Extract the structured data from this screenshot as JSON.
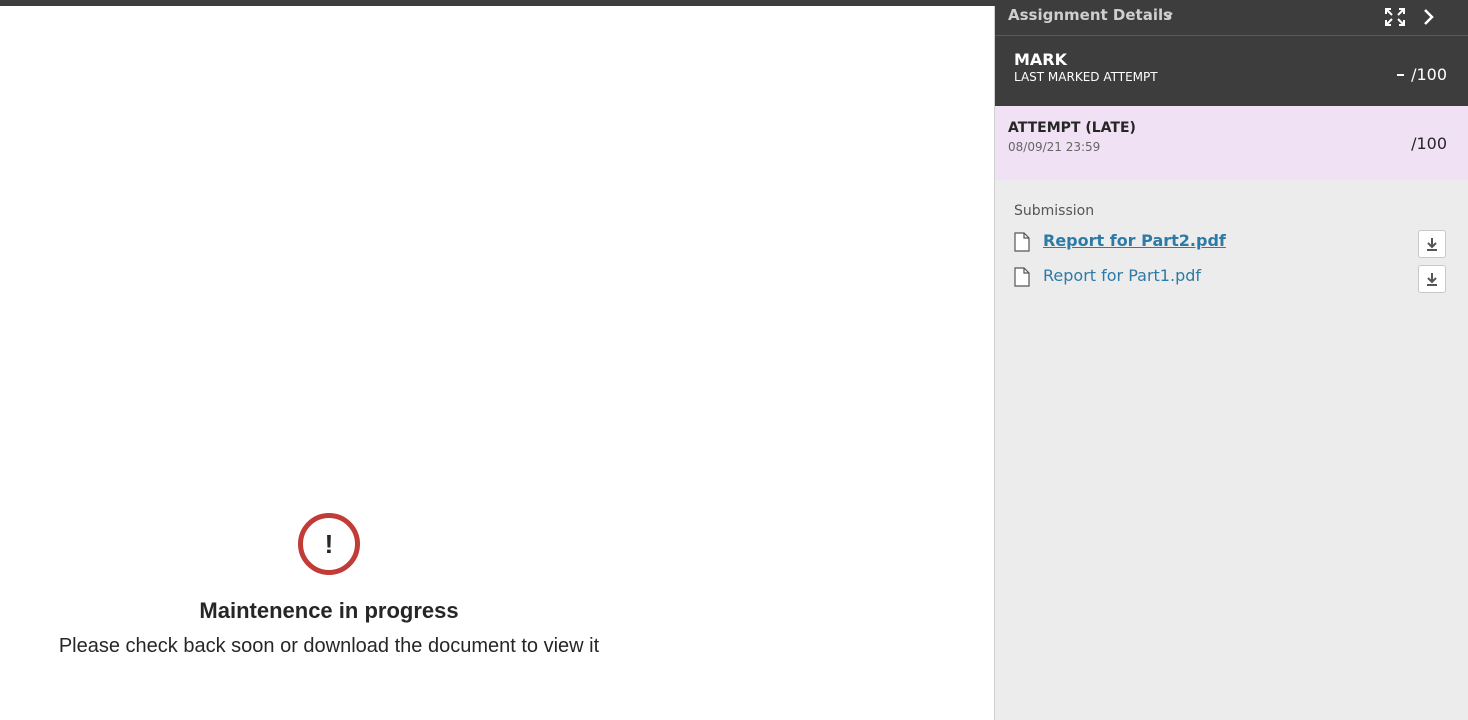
{
  "panel": {
    "title": "Assignment Details",
    "icons": {
      "dropdown": "chevron-down-icon",
      "expand": "expand-icon",
      "next": "chevron-right-icon"
    }
  },
  "mark": {
    "label": "MARK",
    "sublabel": "LAST MARKED ATTEMPT",
    "score": "/100"
  },
  "attempt": {
    "label": "ATTEMPT (LATE)",
    "date": "08/09/21 23:59",
    "score": "/100"
  },
  "submission": {
    "heading": "Submission",
    "files": [
      {
        "name": "Report for Part2.pdf",
        "icon": "file-icon",
        "download_icon": "download-icon"
      },
      {
        "name": "Report for Part1.pdf",
        "icon": "file-icon",
        "download_icon": "download-icon"
      }
    ]
  },
  "viewer": {
    "icon": "alert-icon",
    "title": "Maintenence in progress",
    "message": "Please check back soon or download the document to view it"
  },
  "colors": {
    "dark_header": "#3d3d3d",
    "panel_bg": "#ececec",
    "attempt_bg": "#f1e1f5",
    "alert_red": "#c23b36",
    "link_blue": "#2e7aa6"
  }
}
